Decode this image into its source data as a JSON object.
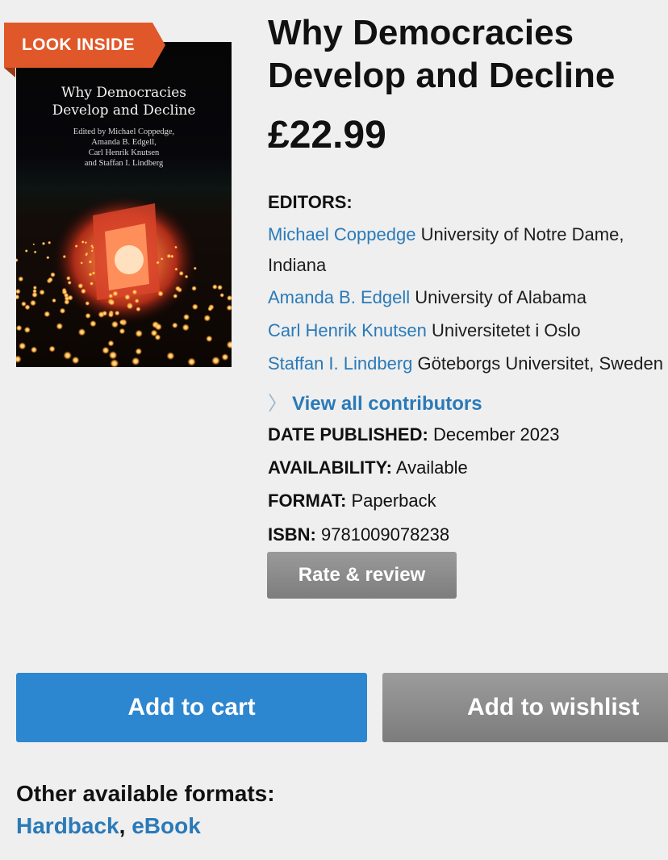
{
  "badge": {
    "look_inside": "LOOK INSIDE"
  },
  "cover": {
    "title": "Why Democracies\nDevelop and Decline",
    "editors_text": "Edited by Michael Coppedge,\nAmanda B. Edgell,\nCarl Henrik Knutsen\nand Staffan I. Lindberg"
  },
  "book": {
    "title_line1": "Why Democracies",
    "title_line2": "Develop and Decline",
    "price": "£22.99"
  },
  "editors": {
    "label": "EDITORS:",
    "items": [
      {
        "name": "Michael Coppedge",
        "affiliation": " University of Notre Dame,",
        "affiliation_line2": "Indiana"
      },
      {
        "name": "Amanda B. Edgell",
        "affiliation": " University of Alabama"
      },
      {
        "name": "Carl Henrik Knutsen",
        "affiliation": " Universitetet i Oslo"
      },
      {
        "name": "Staffan I. Lindberg",
        "affiliation": " Göteborgs Universitet, Sweden"
      }
    ],
    "view_all": "View all contributors"
  },
  "details": {
    "date_label": "DATE PUBLISHED:",
    "date_value": " December 2023",
    "availability_label": "AVAILABILITY:",
    "availability_value": " Available",
    "format_label": "FORMAT:",
    "format_value": " Paperback",
    "isbn_label": "ISBN:",
    "isbn_value": " 9781009078238"
  },
  "actions": {
    "rate_review": "Rate & review",
    "add_to_cart": "Add to cart",
    "add_to_wishlist": "Add to wishlist"
  },
  "formats": {
    "label": "Other available formats:",
    "items": [
      "Hardback",
      "eBook"
    ],
    "separator": ", "
  },
  "colors": {
    "link": "#2a7ab8",
    "cart_button": "#2d86d0",
    "badge": "#e0582a"
  }
}
